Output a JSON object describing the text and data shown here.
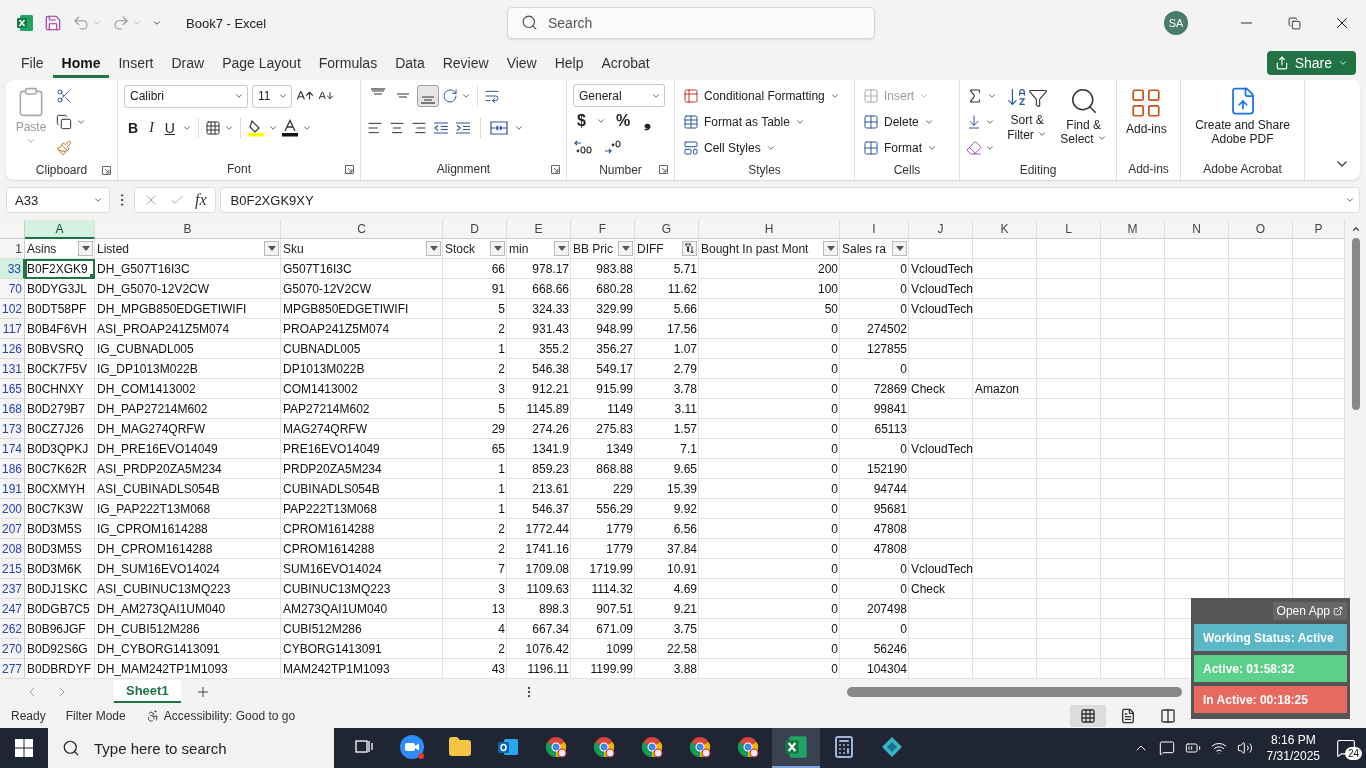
{
  "window": {
    "title": "Book7  -  Excel",
    "search_placeholder": "Search",
    "avatar": "SA"
  },
  "menu_tabs": [
    {
      "label": "File",
      "selected": false
    },
    {
      "label": "Home",
      "selected": true
    },
    {
      "label": "Insert",
      "selected": false
    },
    {
      "label": "Draw",
      "selected": false
    },
    {
      "label": "Page Layout",
      "selected": false
    },
    {
      "label": "Formulas",
      "selected": false
    },
    {
      "label": "Data",
      "selected": false
    },
    {
      "label": "Review",
      "selected": false
    },
    {
      "label": "View",
      "selected": false
    },
    {
      "label": "Help",
      "selected": false
    },
    {
      "label": "Acrobat",
      "selected": false
    }
  ],
  "share": {
    "label": "Share"
  },
  "ribbon": {
    "groups": [
      {
        "kind": "clipboard",
        "label": "Clipboard",
        "items": [
          {
            "label": "Paste",
            "disabled": true
          }
        ]
      },
      {
        "kind": "font",
        "label": "Font",
        "items": [
          {
            "label": "Calibri"
          },
          {
            "label": "11"
          },
          {
            "label": "B"
          },
          {
            "label": "I"
          },
          {
            "label": "U"
          }
        ]
      },
      {
        "kind": "alignment",
        "label": "Alignment",
        "items": [
          {
            "kind": "top",
            "selected": false
          },
          {
            "kind": "middle",
            "selected": false
          },
          {
            "kind": "bottom",
            "selected": true
          }
        ]
      },
      {
        "kind": "number",
        "label": "Number",
        "items": [
          {
            "label": "General"
          },
          {
            "label": "$"
          },
          {
            "label": "%"
          },
          {
            "label": "❟"
          }
        ]
      },
      {
        "kind": "styles",
        "label": "Styles",
        "items": [
          {
            "label": "Conditional Formatting"
          },
          {
            "label": "Format as Table"
          },
          {
            "label": "Cell Styles"
          }
        ]
      },
      {
        "kind": "cells",
        "label": "Cells",
        "items": [
          {
            "label": "Insert",
            "disabled": true
          },
          {
            "label": "Delete",
            "disabled": false
          },
          {
            "label": "Format",
            "disabled": false
          }
        ]
      },
      {
        "kind": "editing",
        "label": "Editing",
        "items": [
          {
            "label": "Sort & Filter"
          },
          {
            "label": "Find & Select"
          }
        ]
      },
      {
        "kind": "addins",
        "label": "Add-ins",
        "items": [
          {
            "label": "Add-ins"
          }
        ]
      },
      {
        "kind": "adobe",
        "label": "Adobe Acrobat",
        "items": [
          {
            "label": "Create and Share Adobe PDF"
          }
        ]
      }
    ]
  },
  "formula_bar": {
    "name_box": "A33",
    "fx": "fx",
    "value": "B0F2XGK9XY"
  },
  "sheet": {
    "columns": [
      {
        "letter": "A",
        "kind": "text",
        "selected": true
      },
      {
        "letter": "B",
        "kind": "text",
        "selected": false
      },
      {
        "letter": "C",
        "kind": "text",
        "selected": false
      },
      {
        "letter": "D",
        "kind": "number",
        "selected": false
      },
      {
        "letter": "E",
        "kind": "number",
        "selected": false
      },
      {
        "letter": "F",
        "kind": "number",
        "selected": false
      },
      {
        "letter": "G",
        "kind": "number",
        "selected": false
      },
      {
        "letter": "H",
        "kind": "number",
        "selected": false
      },
      {
        "letter": "I",
        "kind": "number",
        "selected": false
      },
      {
        "letter": "J",
        "kind": "text",
        "selected": false
      },
      {
        "letter": "K",
        "kind": "text",
        "selected": false
      },
      {
        "letter": "L",
        "selected": false
      },
      {
        "letter": "M",
        "selected": false
      },
      {
        "letter": "N",
        "selected": false
      },
      {
        "letter": "O",
        "selected": false
      },
      {
        "letter": "P",
        "selected": false
      }
    ],
    "header_row_number": "1",
    "headers": [
      {
        "label": "Asins",
        "filtered": false
      },
      {
        "label": "Listed",
        "filtered": false
      },
      {
        "label": "Sku",
        "filtered": false
      },
      {
        "label": "Stock",
        "filtered": false
      },
      {
        "label": "min",
        "filtered": false
      },
      {
        "label": "BB Pric",
        "filtered": false
      },
      {
        "label": "DIFF",
        "filtered": true
      },
      {
        "label": "Bought In past Mont",
        "filtered": false
      },
      {
        "label": "Sales ra",
        "filtered": false
      }
    ],
    "rows": [
      {
        "number": "33",
        "selected": true,
        "cells": [
          "B0F2XGK9",
          "DH_G507T16I3C",
          "G507T16I3C",
          "66",
          "978.17",
          "983.88",
          "5.71",
          "200",
          "0",
          "VcloudTech"
        ]
      },
      {
        "number": "70",
        "selected": false,
        "cells": [
          "B0DYG3JL",
          "DH_G5070-12V2CW",
          "G5070-12V2CW",
          "91",
          "668.66",
          "680.28",
          "11.62",
          "100",
          "0",
          "VcloudTech"
        ]
      },
      {
        "number": "102",
        "selected": false,
        "cells": [
          "B0DT58PF",
          "DH_MPGB850EDGETIWIFI",
          "MPGB850EDGETIWIFI",
          "5",
          "324.33",
          "329.99",
          "5.66",
          "50",
          "0",
          "VcloudTech"
        ]
      },
      {
        "number": "117",
        "selected": false,
        "cells": [
          "B0B4F6VH",
          "ASI_PROAP241Z5M074",
          "PROAP241Z5M074",
          "2",
          "931.43",
          "948.99",
          "17.56",
          "0",
          "274502"
        ]
      },
      {
        "number": "126",
        "selected": false,
        "cells": [
          "B0BVSRQ",
          "IG_CUBNADL005",
          "CUBNADL005",
          "1",
          "355.2",
          "356.27",
          "1.07",
          "0",
          "127855"
        ]
      },
      {
        "number": "131",
        "selected": false,
        "cells": [
          "B0CK7F5V",
          "IG_DP1013M022B",
          "DP1013M022B",
          "2",
          "546.38",
          "549.17",
          "2.79",
          "0",
          "0"
        ]
      },
      {
        "number": "165",
        "selected": false,
        "cells": [
          "B0CHNXY",
          "DH_COM1413002",
          "COM1413002",
          "3",
          "912.21",
          "915.99",
          "3.78",
          "0",
          "72869",
          "Check",
          "Amazon"
        ]
      },
      {
        "number": "168",
        "selected": false,
        "cells": [
          "B0D279B7",
          "DH_PAP27214M602",
          "PAP27214M602",
          "5",
          "1145.89",
          "1149",
          "3.11",
          "0",
          "99841"
        ]
      },
      {
        "number": "173",
        "selected": false,
        "cells": [
          "B0CZ7J26",
          "DH_MAG274QRFW",
          "MAG274QRFW",
          "29",
          "274.26",
          "275.83",
          "1.57",
          "0",
          "65113"
        ]
      },
      {
        "number": "174",
        "selected": false,
        "cells": [
          "B0D3QPKJ",
          "DH_PRE16EVO14049",
          "PRE16EVO14049",
          "65",
          "1341.9",
          "1349",
          "7.1",
          "0",
          "0",
          "VcloudTech"
        ]
      },
      {
        "number": "186",
        "selected": false,
        "cells": [
          "B0C7K62R",
          "ASI_PRDP20ZA5M234",
          "PRDP20ZA5M234",
          "1",
          "859.23",
          "868.88",
          "9.65",
          "0",
          "152190"
        ]
      },
      {
        "number": "191",
        "selected": false,
        "cells": [
          "B0CXMYH",
          "ASI_CUBINADLS054B",
          "CUBINADLS054B",
          "1",
          "213.61",
          "229",
          "15.39",
          "0",
          "94744"
        ]
      },
      {
        "number": "200",
        "selected": false,
        "cells": [
          "B0C7K3W",
          "IG_PAP222T13M068",
          "PAP222T13M068",
          "1",
          "546.37",
          "556.29",
          "9.92",
          "0",
          "95681"
        ]
      },
      {
        "number": "207",
        "selected": false,
        "cells": [
          "B0D3M5S",
          "IG_CPROM1614288",
          "CPROM1614288",
          "2",
          "1772.44",
          "1779",
          "6.56",
          "0",
          "47808"
        ]
      },
      {
        "number": "208",
        "selected": false,
        "cells": [
          "B0D3M5S",
          "DH_CPROM1614288",
          "CPROM1614288",
          "2",
          "1741.16",
          "1779",
          "37.84",
          "0",
          "47808"
        ]
      },
      {
        "number": "215",
        "selected": false,
        "cells": [
          "B0D3M6K",
          "DH_SUM16EVO14024",
          "SUM16EVO14024",
          "7",
          "1709.08",
          "1719.99",
          "10.91",
          "0",
          "0",
          "VcloudTech"
        ]
      },
      {
        "number": "237",
        "selected": false,
        "cells": [
          "B0DJ1SKC",
          "ASI_CUBINUC13MQ223",
          "CUBINUC13MQ223",
          "3",
          "1109.63",
          "1114.32",
          "4.69",
          "0",
          "0",
          "Check"
        ]
      },
      {
        "number": "247",
        "selected": false,
        "cells": [
          "B0DGB7C5",
          "DH_AM273QAI1UM040",
          "AM273QAI1UM040",
          "13",
          "898.3",
          "907.51",
          "9.21",
          "0",
          "207498"
        ]
      },
      {
        "number": "262",
        "selected": false,
        "cells": [
          "B0B96JGF",
          "DH_CUBI512M286",
          "CUBI512M286",
          "4",
          "667.34",
          "671.09",
          "3.75",
          "0",
          "0"
        ]
      },
      {
        "number": "270",
        "selected": false,
        "cells": [
          "B0D92S6G",
          "DH_CYBORG1413091",
          "CYBORG1413091",
          "2",
          "1076.42",
          "1099",
          "22.58",
          "0",
          "56246"
        ]
      },
      {
        "number": "277",
        "selected": false,
        "cells": [
          "B0DBRDYF",
          "DH_MAM242TP1M1093",
          "MAM242TP1M1093",
          "43",
          "1196.11",
          "1199.99",
          "3.88",
          "0",
          "104304"
        ]
      }
    ]
  },
  "sheets": [
    {
      "label": "Sheet1",
      "selected": true
    }
  ],
  "status_bar": {
    "items": [
      "Ready",
      "Filter Mode"
    ],
    "accessibility": "Accessibility: Good to go",
    "views": [
      {
        "kind": "normal",
        "selected": true
      },
      {
        "kind": "page_layout",
        "selected": false
      },
      {
        "kind": "page_break",
        "selected": false
      }
    ]
  },
  "tracker": {
    "open_app": "Open App",
    "status": "Working Status: Active",
    "active": "Active: 01:58:32",
    "inactive": "In Active: 00:18:25"
  },
  "taskbar": {
    "search_placeholder": "Type here to search",
    "apps": [
      {
        "kind": "task_view",
        "active": false
      },
      {
        "kind": "zoom",
        "active": false
      },
      {
        "kind": "explorer",
        "active": false
      },
      {
        "kind": "outlook",
        "active": false
      },
      {
        "kind": "chrome",
        "active": false
      },
      {
        "kind": "chrome",
        "active": false
      },
      {
        "kind": "chrome",
        "active": false
      },
      {
        "kind": "chrome",
        "active": false
      },
      {
        "kind": "chrome",
        "active": false
      },
      {
        "kind": "excel",
        "active": true
      },
      {
        "kind": "calculator",
        "active": false
      },
      {
        "kind": "app",
        "active": false
      }
    ],
    "time": "8:16 PM",
    "date": "7/31/2025",
    "notifications": "24"
  }
}
